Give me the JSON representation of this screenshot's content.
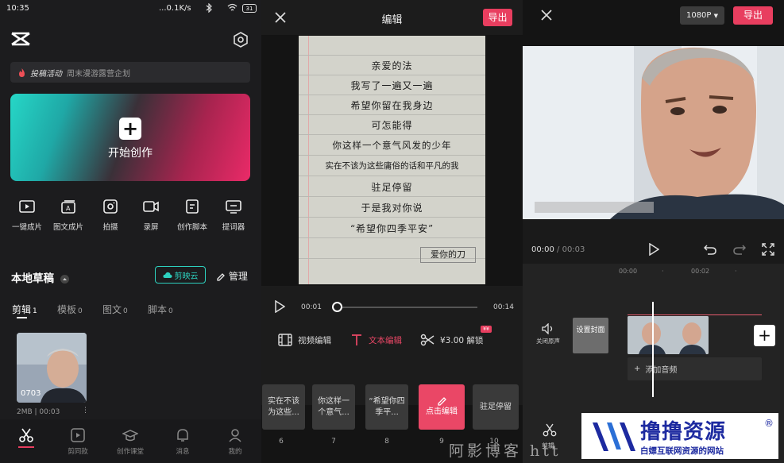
{
  "status": {
    "time": "10:35",
    "speed": "...0.1K/s",
    "battery": "31"
  },
  "home": {
    "promo_tag": "投稿活动",
    "promo_text": "周末漫游露营企划",
    "create_label": "开始创作",
    "tools": [
      {
        "label": "一键成片",
        "icon": "play-square-icon"
      },
      {
        "label": "图文成片",
        "icon": "text-image-icon"
      },
      {
        "label": "拍摄",
        "icon": "camera-icon"
      },
      {
        "label": "录屏",
        "icon": "video-record-icon"
      },
      {
        "label": "创作脚本",
        "icon": "script-icon"
      },
      {
        "label": "提词器",
        "icon": "teleprompter-icon"
      }
    ],
    "drafts_title": "本地草稿",
    "cloud_label": "剪映云",
    "manage_label": "管理",
    "tabs": [
      {
        "label": "剪辑",
        "count": "1"
      },
      {
        "label": "模板",
        "count": "0"
      },
      {
        "label": "图文",
        "count": "0"
      },
      {
        "label": "脚本",
        "count": "0"
      }
    ],
    "draft": {
      "duration": "0703",
      "meta": "2MB | 00:03"
    },
    "nav": [
      {
        "label": "",
        "icon": "scissors-icon"
      },
      {
        "label": "剪同款",
        "icon": "template-icon"
      },
      {
        "label": "创作课堂",
        "icon": "graduation-cap-icon"
      },
      {
        "label": "消息",
        "icon": "bell-icon"
      },
      {
        "label": "我的",
        "icon": "user-icon"
      }
    ]
  },
  "editor": {
    "title": "编辑",
    "export_label": "导出",
    "note_lines": [
      "亲爱的法",
      "我写了一遍又一遍",
      "希望你留在我身边",
      "可怎能得",
      "你这样一个意气风发的少年",
      "实在不该为这些庸俗的话和平凡的我",
      "驻足停留",
      "于是我对你说",
      "“希望你四季平安”"
    ],
    "signature": "爱你的刀",
    "time_current": "00:01",
    "time_total": "00:14",
    "progress": 0.0,
    "video_edit": "视频编辑",
    "text_edit": "文本编辑",
    "unlock": "¥3.00 解锁",
    "clips": [
      {
        "text": "实在不该为这些...",
        "num": "6"
      },
      {
        "text": "你这样一个意气...",
        "num": "7"
      },
      {
        "text": "“希望你四季平...",
        "num": "8"
      },
      {
        "text": "点击编辑",
        "num": "9"
      },
      {
        "text": "驻足停留",
        "num": "10"
      }
    ]
  },
  "preview": {
    "resolution": "1080P",
    "export_label": "导出",
    "time_current": "00:00",
    "time_total": "00:03",
    "ruler": [
      "00:00",
      "00:02"
    ],
    "mute_label": "关闭原声",
    "cover_label": "设置封面",
    "add_audio": "添加音频",
    "cut_label": "剪辑"
  },
  "brand": {
    "name": "撸撸资源",
    "reg": "®",
    "sub": "白嫖互联网资源的网站"
  },
  "watermark": "阿影博客 htt",
  "colors": {
    "accent": "#e83e5f",
    "teal": "#2dd1bf"
  }
}
